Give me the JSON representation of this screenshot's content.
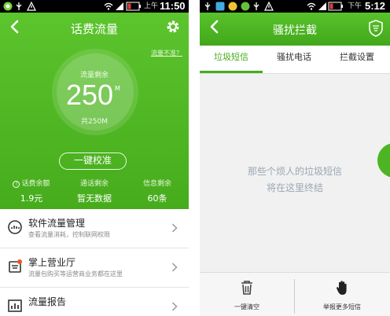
{
  "left": {
    "status": {
      "ampm": "上午",
      "time": "11:50"
    },
    "header": {
      "title": "话费流量",
      "link": "流量不准？"
    },
    "gauge": {
      "label": "流量剩余",
      "value": "250",
      "unit": "M",
      "total": "共250M"
    },
    "calibrate_button": "一键校准",
    "stats": [
      {
        "label": "话费余额",
        "value": "1.9元"
      },
      {
        "label": "通话剩余",
        "value": "暂无数据"
      },
      {
        "label": "信息剩余",
        "value": "60条"
      }
    ],
    "menu": [
      {
        "title": "软件流量管理",
        "subtitle": "查看流量消耗，控制联网权限"
      },
      {
        "title": "掌上营业厅",
        "subtitle": "流量包购买等运营商业务都在这里"
      },
      {
        "title": "流量报告",
        "subtitle": ""
      }
    ]
  },
  "right": {
    "status": {
      "ampm": "下午",
      "time": "5:12"
    },
    "header": {
      "title": "骚扰拦截"
    },
    "tabs": [
      "垃圾短信",
      "骚扰电话",
      "拦截设置"
    ],
    "empty_message": [
      "那些个烦人的垃圾短信",
      "将在这里终结"
    ],
    "bottom": {
      "clear_label": "一键清空",
      "report_label": "举报更多短信"
    }
  },
  "colors": {
    "brand_green": "#46ac1c",
    "empty_text": "#9aa7b3"
  }
}
